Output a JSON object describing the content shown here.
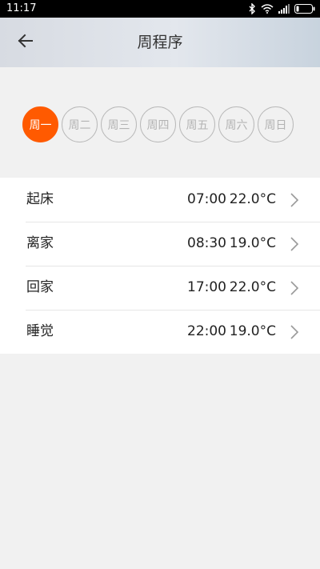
{
  "status_bar": {
    "time": "11:17",
    "icons": [
      "bluetooth-icon",
      "wifi-icon",
      "signal-icon",
      "battery-icon"
    ]
  },
  "header": {
    "back_icon": "arrow-left-icon",
    "title": "周程序"
  },
  "days": [
    {
      "label": "周一",
      "selected": true
    },
    {
      "label": "周二",
      "selected": false
    },
    {
      "label": "周三",
      "selected": false
    },
    {
      "label": "周四",
      "selected": false
    },
    {
      "label": "周五",
      "selected": false
    },
    {
      "label": "周六",
      "selected": false
    },
    {
      "label": "周日",
      "selected": false
    }
  ],
  "schedule": [
    {
      "label": "起床",
      "time": "07:00",
      "temp": "22.0°C"
    },
    {
      "label": "离家",
      "time": "08:30",
      "temp": "19.0°C"
    },
    {
      "label": "回家",
      "time": "17:00",
      "temp": "22.0°C"
    },
    {
      "label": "睡觉",
      "time": "22:00",
      "temp": "19.0°C"
    }
  ],
  "colors": {
    "accent": "#ff5a00",
    "background": "#f1f1f1",
    "inactive_day": "#b3b3b3"
  }
}
